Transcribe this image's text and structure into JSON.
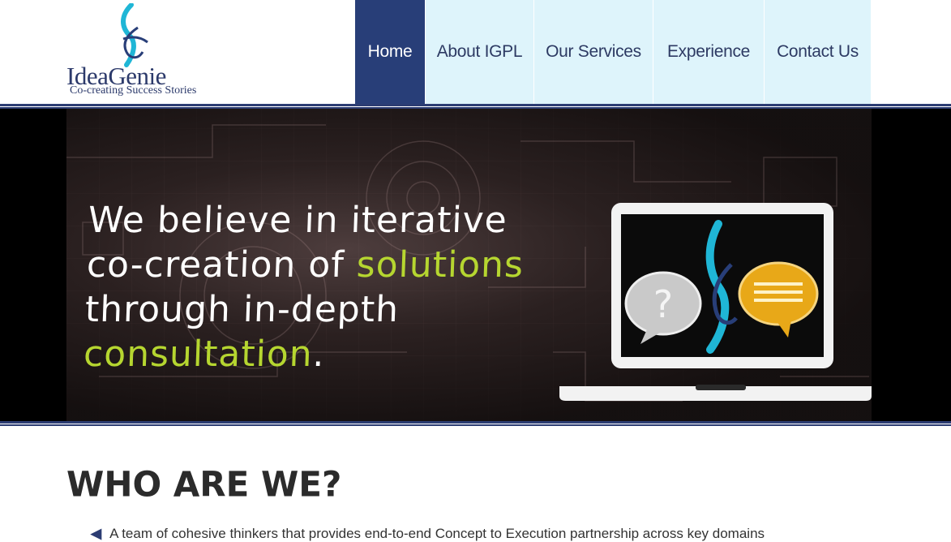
{
  "brand": {
    "name_part1": "Idea",
    "name_part2": "Genie",
    "tagline": "Co-creating Success Stories",
    "colors": {
      "navy": "#283e78",
      "teal": "#1fb6d6",
      "light_blue": "#def4fb",
      "green": "#b6d630"
    }
  },
  "nav": {
    "items": [
      {
        "label": "Home",
        "active": true
      },
      {
        "label": "About IGPL",
        "active": false
      },
      {
        "label": "Our Services",
        "active": false
      },
      {
        "label": "Experience",
        "active": false
      },
      {
        "label": "Contact Us",
        "active": false
      }
    ]
  },
  "banner": {
    "line1": "We believe in iterative",
    "line2_a": "co-creation of ",
    "line2_b": "solutions",
    "line3": "through in-depth",
    "line4_a": "consultation",
    "line4_b": ".",
    "icons": [
      "laptop-icon",
      "question-bubble-icon",
      "message-bubble-icon"
    ]
  },
  "section": {
    "title": "WHO ARE WE?",
    "bullets": [
      "A team of cohesive thinkers that provides end-to-end Concept to Execution partnership across key domains"
    ]
  }
}
